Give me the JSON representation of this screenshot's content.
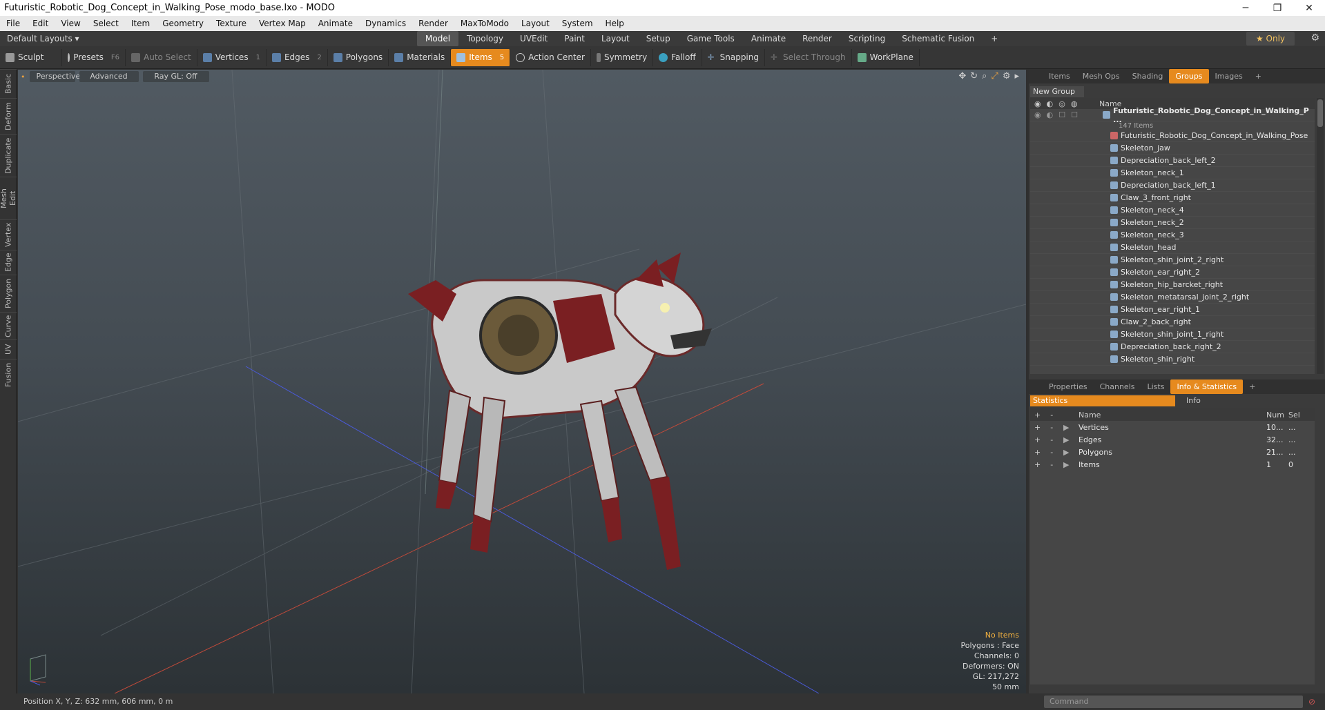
{
  "window": {
    "title": "Futuristic_Robotic_Dog_Concept_in_Walking_Pose_modo_base.lxo - MODO",
    "minimize": "─",
    "maximize": "❐",
    "close": "✕"
  },
  "menu": [
    "File",
    "Edit",
    "View",
    "Select",
    "Item",
    "Geometry",
    "Texture",
    "Vertex Map",
    "Animate",
    "Dynamics",
    "Render",
    "MaxToModo",
    "Layout",
    "System",
    "Help"
  ],
  "layoutbar": {
    "layout": "Default Layouts ▾",
    "tabs": [
      "Model",
      "Topology",
      "UVEdit",
      "Paint",
      "Layout",
      "Setup",
      "Game Tools",
      "Animate",
      "Render",
      "Scripting",
      "Schematic Fusion",
      "+"
    ],
    "active_tab": "Model",
    "only": "★ Only"
  },
  "toolbar": {
    "sculpt": "Sculpt",
    "presets": "Presets",
    "presets_key": "F6",
    "auto_select": "Auto Select",
    "vertices": "Vertices",
    "vertices_key": "1",
    "edges": "Edges",
    "edges_key": "2",
    "polygons": "Polygons",
    "materials": "Materials",
    "items": "Items",
    "items_key": "5",
    "action_center": "Action Center",
    "symmetry": "Symmetry",
    "falloff": "Falloff",
    "snapping": "Snapping",
    "select_through": "Select Through",
    "workplane": "WorkPlane"
  },
  "lefttabs": [
    "Basic",
    "Deform",
    "Duplicate",
    "Mesh Edit",
    "Vertex",
    "Edge",
    "Polygon",
    "Curve",
    "UV",
    "Fusion"
  ],
  "viewport": {
    "view": "Perspective",
    "style": "Advanced",
    "raygl": "Ray GL: Off",
    "stats": {
      "items": "No Items",
      "polygons": "Polygons : Face",
      "channels": "Channels: 0",
      "deformers": "Deformers: ON",
      "gl": "GL: 217,272",
      "size": "50 mm"
    }
  },
  "panel_top": {
    "tabs": [
      "Items",
      "Mesh Ops",
      "Shading",
      "Groups",
      "Images",
      "+"
    ],
    "active": "Groups",
    "new_group": "New Group",
    "col_name": "Name",
    "root": "Futuristic_Robotic_Dog_Concept_in_Walking_P ...",
    "root_count": "147 Items",
    "items": [
      "Futuristic_Robotic_Dog_Concept_in_Walking_Pose",
      "Skeleton_jaw",
      "Depreciation_back_left_2",
      "Skeleton_neck_1",
      "Depreciation_back_left_1",
      "Claw_3_front_right",
      "Skeleton_neck_4",
      "Skeleton_neck_2",
      "Skeleton_neck_3",
      "Skeleton_head",
      "Skeleton_shin_joint_2_right",
      "Skeleton_ear_right_2",
      "Skeleton_hip_barcket_right",
      "Skeleton_metatarsal_joint_2_right",
      "Skeleton_ear_right_1",
      "Claw_2_back_right",
      "Skeleton_shin_joint_1_right",
      "Depreciation_back_right_2",
      "Skeleton_shin_right"
    ]
  },
  "panel_bottom": {
    "tabs": [
      "Properties",
      "Channels",
      "Lists",
      "Info & Statistics",
      "+"
    ],
    "active": "Info & Statistics",
    "statistics": "Statistics",
    "info": "Info",
    "cols": {
      "name": "Name",
      "num": "Num",
      "sel": "Sel"
    },
    "rows": [
      {
        "name": "Vertices",
        "num": "10...",
        "sel": "..."
      },
      {
        "name": "Edges",
        "num": "32...",
        "sel": "..."
      },
      {
        "name": "Polygons",
        "num": "21...",
        "sel": "..."
      },
      {
        "name": "Items",
        "num": "1",
        "sel": "0"
      }
    ]
  },
  "command": {
    "placeholder": "Command"
  },
  "status": "Position X, Y, Z:  632 mm, 606 mm, 0 m"
}
